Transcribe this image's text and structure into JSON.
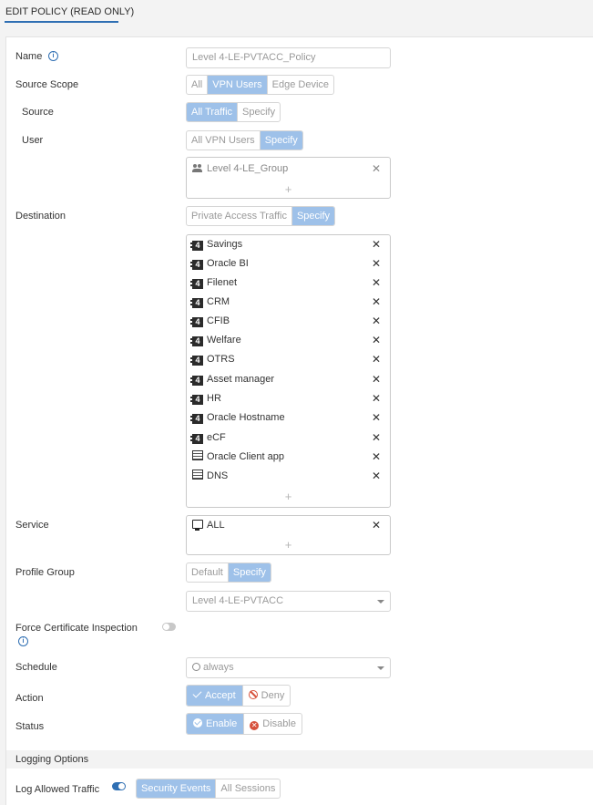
{
  "header": {
    "title": "EDIT POLICY (READ ONLY)"
  },
  "form": {
    "name": {
      "label": "Name",
      "value": "Level 4-LE-PVTACC_Policy"
    },
    "source_scope": {
      "label": "Source Scope",
      "options": [
        "All",
        "VPN Users",
        "Edge Device"
      ],
      "selected": "VPN Users"
    },
    "source": {
      "label": "Source",
      "options": [
        "All Traffic",
        "Specify"
      ],
      "selected": "All Traffic"
    },
    "user": {
      "label": "User",
      "options": [
        "All VPN Users",
        "Specify"
      ],
      "selected": "Specify",
      "items": [
        {
          "icon": "users-group-icon",
          "label": "Level 4-LE_Group"
        }
      ],
      "add_symbol": "+"
    },
    "destination": {
      "label": "Destination",
      "options": [
        "Private Access Traffic",
        "Specify"
      ],
      "selected": "Specify",
      "items": [
        {
          "icon": "layer4-app-icon",
          "label": "Savings"
        },
        {
          "icon": "layer4-app-icon",
          "label": "Oracle BI"
        },
        {
          "icon": "layer4-app-icon",
          "label": "Filenet"
        },
        {
          "icon": "layer4-app-icon",
          "label": "CRM"
        },
        {
          "icon": "layer4-app-icon",
          "label": "CFIB"
        },
        {
          "icon": "layer4-app-icon",
          "label": "Welfare"
        },
        {
          "icon": "layer4-app-icon",
          "label": "OTRS"
        },
        {
          "icon": "layer4-app-icon",
          "label": "Asset manager"
        },
        {
          "icon": "layer4-app-icon",
          "label": "HR"
        },
        {
          "icon": "layer4-app-icon",
          "label": "Oracle Hostname"
        },
        {
          "icon": "layer4-app-icon",
          "label": "eCF"
        },
        {
          "icon": "client-app-icon",
          "label": "Oracle Client app"
        },
        {
          "icon": "dns-server-icon",
          "label": "DNS"
        }
      ],
      "remove_symbol": "✕",
      "add_symbol": "+"
    },
    "service": {
      "label": "Service",
      "items": [
        {
          "icon": "monitor-icon",
          "label": "ALL"
        }
      ],
      "add_symbol": "+"
    },
    "profile_group": {
      "label": "Profile Group",
      "options": [
        "Default",
        "Specify"
      ],
      "selected": "Specify",
      "value": "Level 4-LE-PVTACC"
    },
    "force_cert": {
      "label": "Force Certificate Inspection",
      "enabled": false
    },
    "schedule": {
      "label": "Schedule",
      "value": "always"
    },
    "action": {
      "label": "Action",
      "options": [
        "Accept",
        "Deny"
      ],
      "selected": "Accept"
    },
    "status": {
      "label": "Status",
      "options": [
        "Enable",
        "Disable"
      ],
      "selected": "Enable"
    }
  },
  "logging": {
    "section_title": "Logging Options",
    "log_allowed": {
      "label": "Log Allowed Traffic",
      "enabled": true,
      "options": [
        "Security Events",
        "All Sessions"
      ],
      "selected": "Security Events"
    }
  },
  "colors": {
    "accent": "#2f6fb3",
    "active_segment": "#9ec1e9",
    "danger": "#d6503b"
  }
}
